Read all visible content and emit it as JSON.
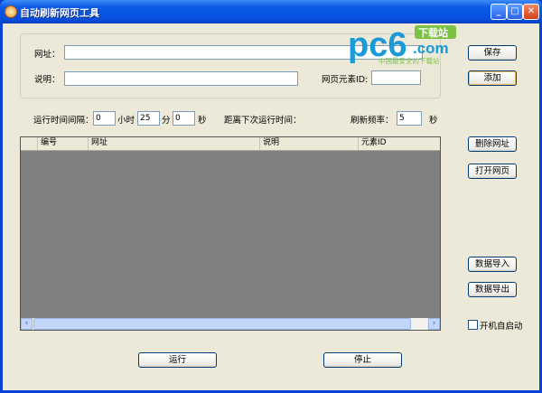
{
  "window": {
    "title": "自动刷新网页工具",
    "minimize": "_",
    "maximize": "□",
    "close": "✕"
  },
  "form": {
    "url_label": "网址：",
    "url_value": "",
    "desc_label": "说明：",
    "desc_value": "",
    "element_id_label": "网页元素ID:",
    "element_id_value": ""
  },
  "buttons": {
    "save": "保存",
    "add": "添加",
    "delete_url": "删除网址",
    "open_page": "打开网页",
    "import": "数据导入",
    "export": "数据导出",
    "run": "运行",
    "stop": "停止"
  },
  "schedule": {
    "interval_label": "运行时间间隔：",
    "hours_value": "0",
    "hours_label": "小时",
    "minutes_value": "25",
    "minutes_label": "分",
    "seconds_value": "0",
    "seconds_label": "秒",
    "next_run_label": "距离下次运行时间：",
    "refresh_label": "刷新频率：",
    "refresh_value": "5",
    "refresh_unit": "秒"
  },
  "table": {
    "columns": [
      "",
      "编号",
      "网址",
      "说明",
      "元素ID"
    ],
    "rows": []
  },
  "autostart": {
    "label": "开机自启动",
    "checked": false
  },
  "watermark": {
    "brand": "pc6",
    "tag": "下载站",
    "domain": ".com",
    "slogan": "中国最安全的下载站",
    "color": "#1a9ad6",
    "accent": "#7cc142"
  }
}
